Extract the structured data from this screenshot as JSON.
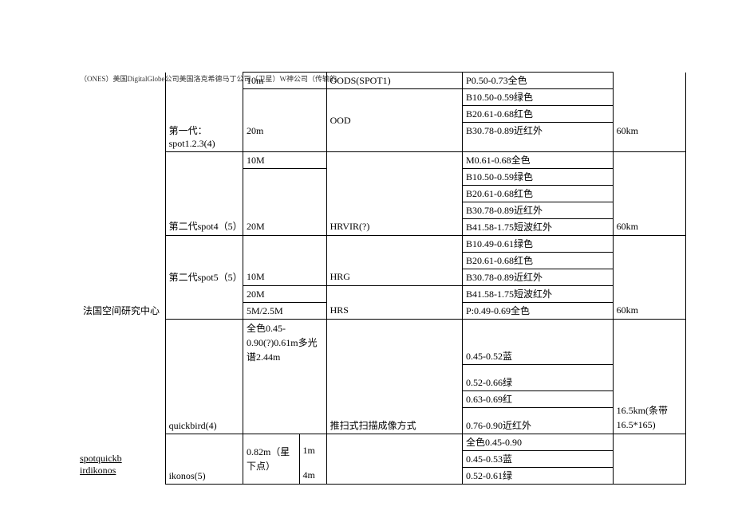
{
  "topnote": "（ONES）美国DigitalGlobe公司美国洛克希德马丁公司（卫星）W神公司（传输的",
  "col1_org": "法国空间研究中心",
  "gen1_name": "第一代：spot1.2.3(4)",
  "gen2a_name": "第二代spot4（5）",
  "gen2b_name": "第二代spot5（5）",
  "qb_name": "quickbird(4)",
  "ik_name": "ikonos(5)",
  "r1_c3": "10m",
  "r1_c4": "OODS(SPOT1)",
  "r1_c5": "P0.50-0.73全色",
  "r2_c4": "OOD",
  "r2_c5": "B10.50-0.59绿色",
  "r3_c5": "B20.61-0.68红色",
  "r4_c3": "20m",
  "r4_c5": "B30.78-0.89近红外",
  "r4_c6": "60km",
  "r5_c3": "10M",
  "r5_c5": "M0.61-0.68全色",
  "r6_c5": "B10.50-0.59绿色",
  "r7_c5": "B20.61-0.68红色",
  "r8_c5": "B30.78-0.89近红外",
  "r9_c3": "20M",
  "r9_c4": "HRVIR(?)",
  "r9_c5": "B41.58-1.75短波红外",
  "r9_c6": "60km",
  "r10_c5": "B10.49-0.61绿色",
  "r11_c5": "B20.61-0.68红色",
  "r12_c3": "10M",
  "r12_c4": "HRG",
  "r12_c5": "B30.78-0.89近红外",
  "r13_c3": "20M",
  "r13_c5": "B41.58-1.75短波红外",
  "r14_c3": "5M/2.5M",
  "r14_c4": "HRS",
  "r14_c5": "P:0.49-0.69全色",
  "r14_c6": "60km",
  "qb_c3": "全色0.45-0.90(?)0.61m多光谱2.44m",
  "qb_c4": "推扫式扫描成像方式",
  "qb_r1_c5": "0.45-0.52蓝",
  "qb_r2_c5": "0.52-0.66绿",
  "qb_r3_c5": "0.63-0.69红",
  "qb_r4_c5": "0.76-0.90近红外",
  "qb_c6": "16.5km(条带16.5*165)",
  "ik_c3a": "0.82m（星下点）",
  "ik_c3b_top": "1m",
  "ik_c3b_bot": "4m",
  "ik_r1_c5": "全色0.45-0.90",
  "ik_r2_c5": "0.45-0.53蓝",
  "ik_r3_c5": "0.52-0.61绿",
  "bottomlabel": "spotquickbirdikonos"
}
